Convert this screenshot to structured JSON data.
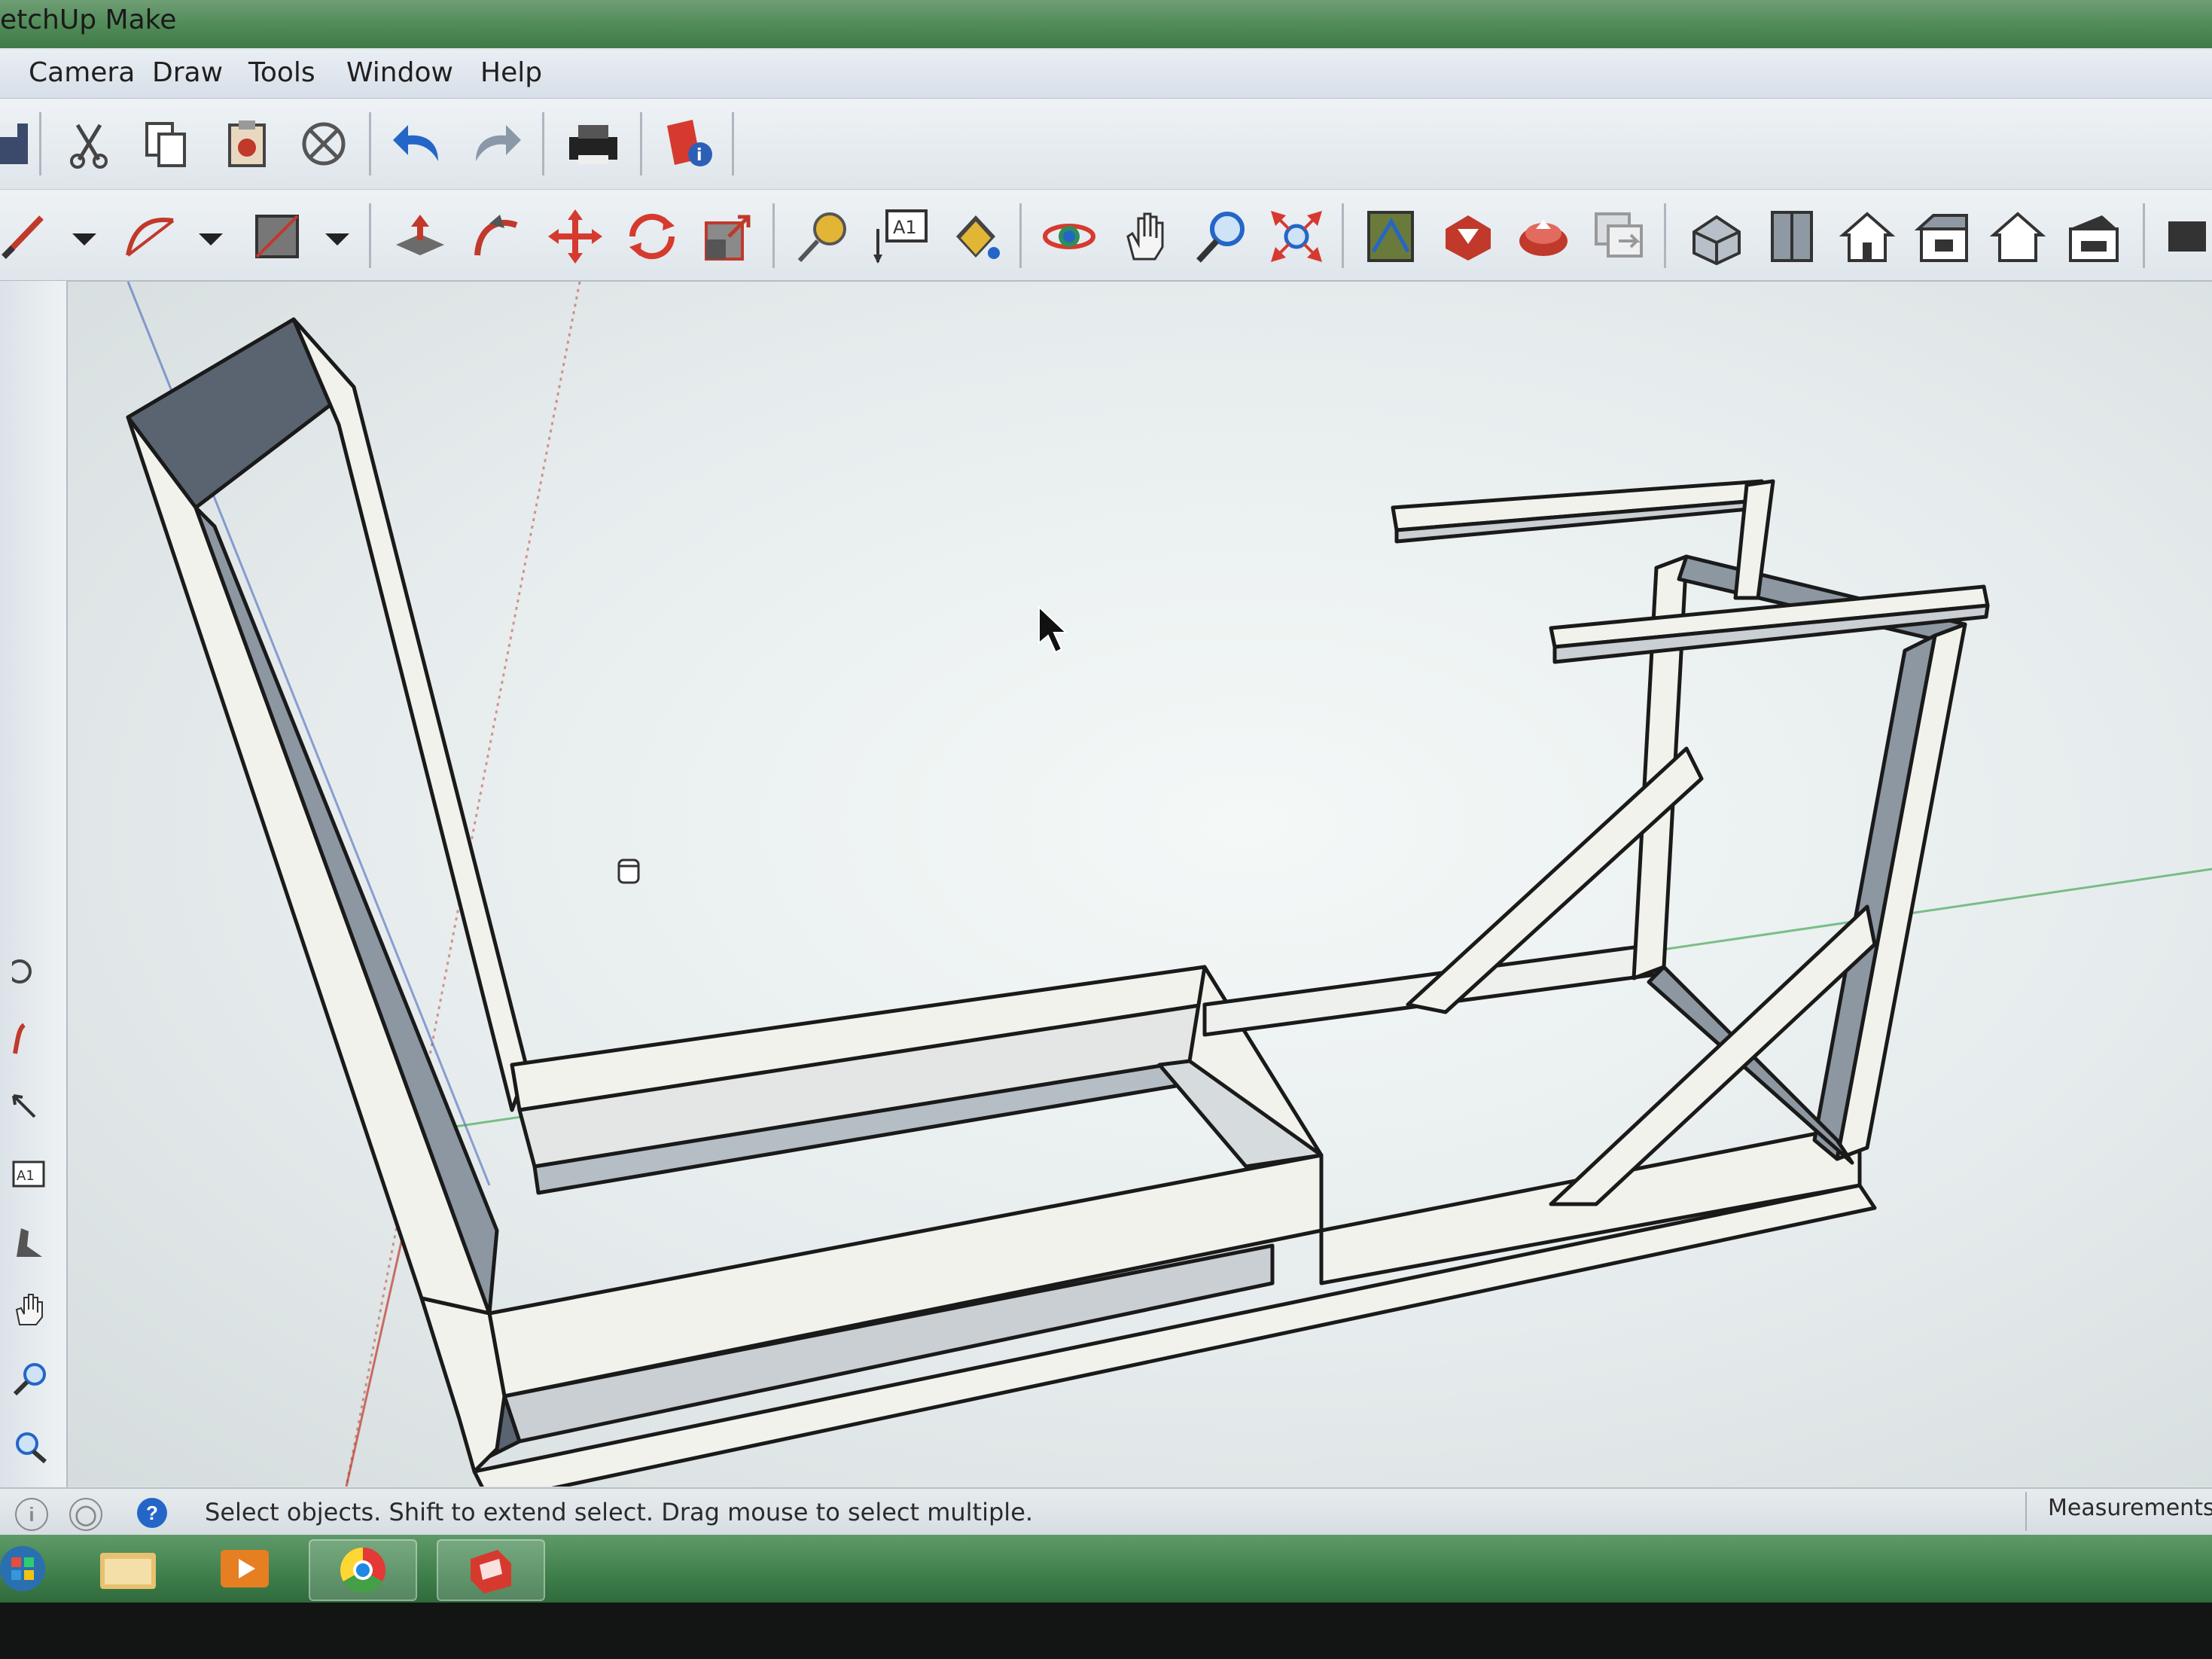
{
  "window": {
    "title": "etchUp Make"
  },
  "menu": {
    "items": [
      "Camera",
      "Draw",
      "Tools",
      "Window",
      "Help"
    ]
  },
  "status": {
    "hint": "Select objects. Shift to extend select. Drag mouse to select multiple.",
    "measurements_label": "Measurements"
  },
  "toolbar1": {
    "icons": [
      "save-icon",
      "cut-icon",
      "copy-icon",
      "paste-icon",
      "erase-icon",
      "undo-icon",
      "redo-icon",
      "print-icon",
      "model-info-icon"
    ]
  },
  "toolbar2": {
    "icons": [
      "line-icon",
      "arc-icon",
      "rectangle-icon",
      "push-pull-icon",
      "follow-me-icon",
      "move-icon",
      "rotate-icon",
      "scale-icon",
      "tape-measure-icon",
      "text-icon",
      "paint-bucket-icon",
      "orbit-icon",
      "pan-icon",
      "zoom-icon",
      "zoom-extents-icon",
      "previous-view-icon",
      "get-models-icon",
      "share-model-icon",
      "extension-icon",
      "iso-view-icon",
      "top-view-icon",
      "front-view-icon",
      "right-view-icon",
      "back-view-icon",
      "left-view-icon"
    ]
  },
  "left_toolbar": {
    "icons": [
      "orbit-icon",
      "follow-me-icon",
      "dimension-icon",
      "text-icon",
      "walk-icon",
      "pan-icon",
      "zoom-icon",
      "look-around-icon"
    ]
  },
  "taskbar": {
    "apps": [
      "start-button",
      "explorer-icon",
      "media-player-icon",
      "chrome-icon",
      "sketchup-icon"
    ]
  },
  "colors": {
    "title_bar": "#4f8a57",
    "model_face_light": "#f2f2ec",
    "model_face_shaded": "#9ea9b3",
    "model_edge": "#1a1a1a",
    "red_axis": "#c0392b",
    "green_axis": "#2e9e44",
    "blue_axis": "#2b4fb5"
  }
}
